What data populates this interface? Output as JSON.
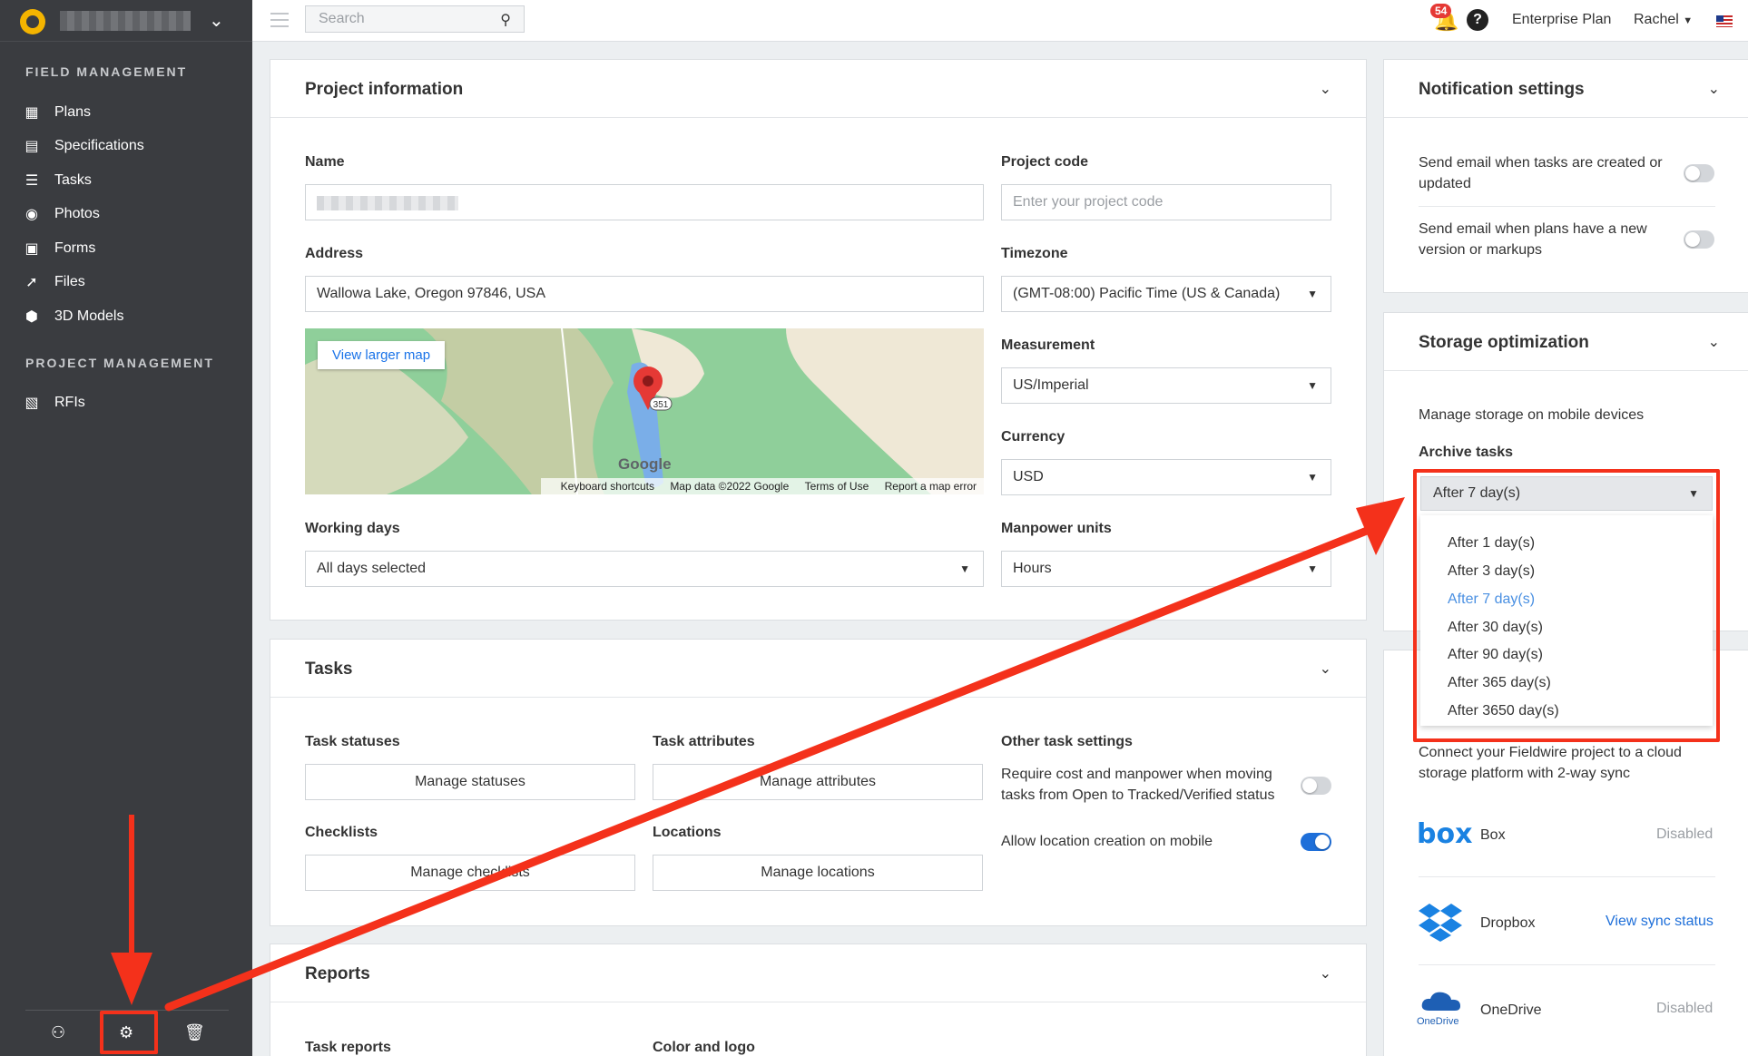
{
  "sidebar": {
    "sections": [
      {
        "title": "FIELD MANAGEMENT"
      },
      {
        "title": "PROJECT MANAGEMENT"
      }
    ],
    "items": [
      {
        "label": "Plans",
        "icon": "plans-icon"
      },
      {
        "label": "Specifications",
        "icon": "specifications-icon"
      },
      {
        "label": "Tasks",
        "icon": "tasks-icon"
      },
      {
        "label": "Photos",
        "icon": "camera-icon"
      },
      {
        "label": "Forms",
        "icon": "clipboard-icon"
      },
      {
        "label": "Files",
        "icon": "paperclip-icon"
      },
      {
        "label": "3D Models",
        "icon": "cube-icon"
      },
      {
        "label": "RFIs",
        "icon": "rfi-icon"
      }
    ]
  },
  "topbar": {
    "search_placeholder": "Search",
    "notifications_count": "54",
    "help_glyph": "?",
    "plan": "Enterprise Plan",
    "user": "Rachel"
  },
  "project_info": {
    "title": "Project information",
    "name_label": "Name",
    "project_code_label": "Project code",
    "project_code_placeholder": "Enter your project code",
    "address_label": "Address",
    "address_value": "Wallowa Lake, Oregon 97846, USA",
    "timezone_label": "Timezone",
    "timezone_value": "(GMT-08:00) Pacific Time (US & Canada)",
    "measurement_label": "Measurement",
    "measurement_value": "US/Imperial",
    "currency_label": "Currency",
    "currency_value": "USD",
    "working_days_label": "Working days",
    "working_days_value": "All days selected",
    "manpower_label": "Manpower units",
    "manpower_value": "Hours",
    "map": {
      "view_larger": "View larger map",
      "route_marker": "351",
      "google": "Google",
      "footer": [
        "Keyboard shortcuts",
        "Map data ©2022 Google",
        "Terms of Use",
        "Report a map error"
      ]
    }
  },
  "tasks": {
    "title": "Tasks",
    "statuses_label": "Task statuses",
    "statuses_button": "Manage statuses",
    "attributes_label": "Task attributes",
    "attributes_button": "Manage attributes",
    "other_label": "Other task settings",
    "require_cost_text": "Require cost and manpower when moving tasks from Open to Tracked/Verified status",
    "allow_location_text": "Allow location creation on mobile",
    "checklists_label": "Checklists",
    "checklists_button": "Manage checklists",
    "locations_label": "Locations",
    "locations_button": "Manage locations"
  },
  "reports": {
    "title": "Reports",
    "task_reports_label": "Task reports",
    "color_logo_label": "Color and logo"
  },
  "notifications": {
    "title": "Notification settings",
    "items": [
      {
        "text": "Send email when tasks are created or updated"
      },
      {
        "text": "Send email when plans have a new version or markups"
      }
    ]
  },
  "storage": {
    "title": "Storage optimization",
    "manage_text": "Manage storage on mobile devices",
    "archive_label": "Archive tasks",
    "selected": "After 7 day(s)",
    "options": [
      "After 1 day(s)",
      "After 3 day(s)",
      "After 7 day(s)",
      "After 30 day(s)",
      "After 90 day(s)",
      "After 365 day(s)",
      "After 3650 day(s)"
    ]
  },
  "integrations": {
    "description": "Connect your Fieldwire project to a cloud storage platform with 2-way sync",
    "items": [
      {
        "name": "Box",
        "logo_text": "box",
        "status": "Disabled"
      },
      {
        "name": "Dropbox",
        "status": "View sync status"
      },
      {
        "name": "OneDrive",
        "logo_text": "OneDrive",
        "status": "Disabled"
      }
    ]
  },
  "colors": {
    "annotation_red": "#f4311b",
    "accent_blue": "#1e6fd9",
    "sidebar_bg": "#3a3c40"
  }
}
